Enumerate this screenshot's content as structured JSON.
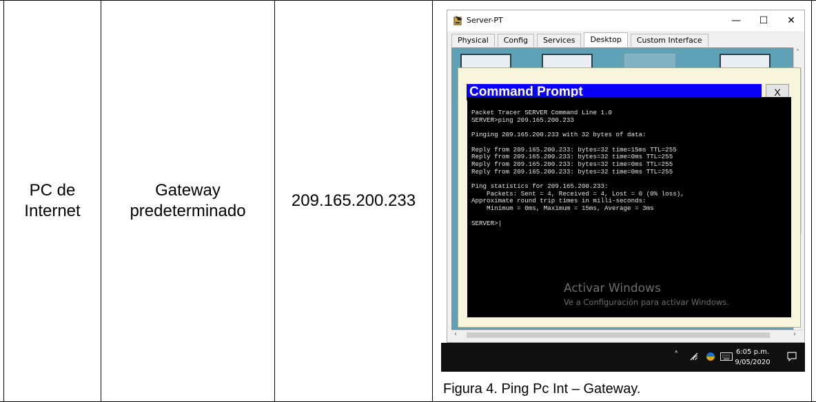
{
  "table": {
    "col1": [
      "PC de",
      "Internet"
    ],
    "col2": [
      "Gateway",
      "predeterminado"
    ],
    "col3": "209.165.200.233"
  },
  "window": {
    "title": "Server-PT",
    "controls": {
      "minimize": "—",
      "maximize": "☐",
      "close": "✕"
    },
    "tabs": [
      "Physical",
      "Config",
      "Services",
      "Desktop",
      "Custom Interface"
    ],
    "active_tab": "Desktop"
  },
  "command_prompt": {
    "title": "Command Prompt",
    "close_label": "X",
    "lines": [
      "Packet Tracer SERVER Command Line 1.0",
      "SERVER>ping 209.165.200.233",
      "",
      "Pinging 209.165.200.233 with 32 bytes of data:",
      "",
      "Reply from 209.165.200.233: bytes=32 time=15ms TTL=255",
      "Reply from 209.165.200.233: bytes=32 time=0ms TTL=255",
      "Reply from 209.165.200.233: bytes=32 time=0ms TTL=255",
      "Reply from 209.165.200.233: bytes=32 time=0ms TTL=255",
      "",
      "Ping statistics for 209.165.200.233:",
      "    Packets: Sent = 4, Received = 4, Lost = 0 (0% loss),",
      "Approximate round trip times in milli-seconds:",
      "    Minimum = 0ms, Maximum = 15ms, Average = 3ms",
      "",
      "SERVER>|"
    ],
    "watermark_title": "Activar Windows",
    "watermark_sub": "Ve a Configuración para activar Windows."
  },
  "taskbar": {
    "time": "6:05 p.m.",
    "date": "9/05/2020",
    "icons": [
      "chevron-up-icon",
      "wifi-icon",
      "network-icon",
      "keyboard-icon",
      "notification-icon"
    ]
  },
  "caption": "Figura 4. Ping Pc Int – Gateway.",
  "colors": {
    "dialog_header": "#0a00f5",
    "desktop_bg": "#5fa2b8",
    "dialog_bg": "#f7f5dc",
    "terminal_bg": "#000000"
  }
}
